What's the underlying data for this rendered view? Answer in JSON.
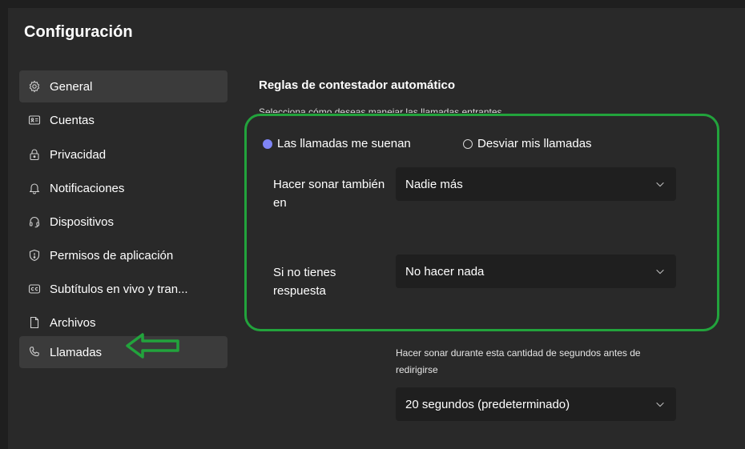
{
  "window": {
    "title": "Configuración"
  },
  "sidebar": {
    "items": [
      {
        "label": "General",
        "icon": "gear-icon",
        "selected": true
      },
      {
        "label": "Cuentas",
        "icon": "id-card-icon",
        "selected": false
      },
      {
        "label": "Privacidad",
        "icon": "lock-icon",
        "selected": false
      },
      {
        "label": "Notificaciones",
        "icon": "bell-icon",
        "selected": false
      },
      {
        "label": "Dispositivos",
        "icon": "headset-icon",
        "selected": false
      },
      {
        "label": "Permisos de aplicación",
        "icon": "shield-icon",
        "selected": false
      },
      {
        "label": "Subtítulos en vivo y tran...",
        "icon": "closed-caption-icon",
        "selected": false
      },
      {
        "label": "Archivos",
        "icon": "file-icon",
        "selected": false
      },
      {
        "label": "Llamadas",
        "icon": "phone-icon",
        "selected": true
      }
    ]
  },
  "main": {
    "section_title": "Reglas de contestador automático",
    "section_desc": "Selecciona cómo deseas manejar las llamadas entrantes",
    "radio_options": [
      {
        "label": "Las llamadas me suenan",
        "checked": true
      },
      {
        "label": "Desviar mis llamadas",
        "checked": false
      }
    ],
    "ring_also": {
      "label": "Hacer sonar también en",
      "value": "Nadie más"
    },
    "no_answer": {
      "label": "Si no tienes respuesta",
      "value": "No hacer nada"
    },
    "ring_delay": {
      "label": "Hacer sonar durante esta cantidad de segundos antes de redirigirse",
      "value": "20 segundos (predeterminado)"
    }
  },
  "annotations": {
    "highlight_color": "#22a33c",
    "accent_color": "#7f85f5"
  }
}
